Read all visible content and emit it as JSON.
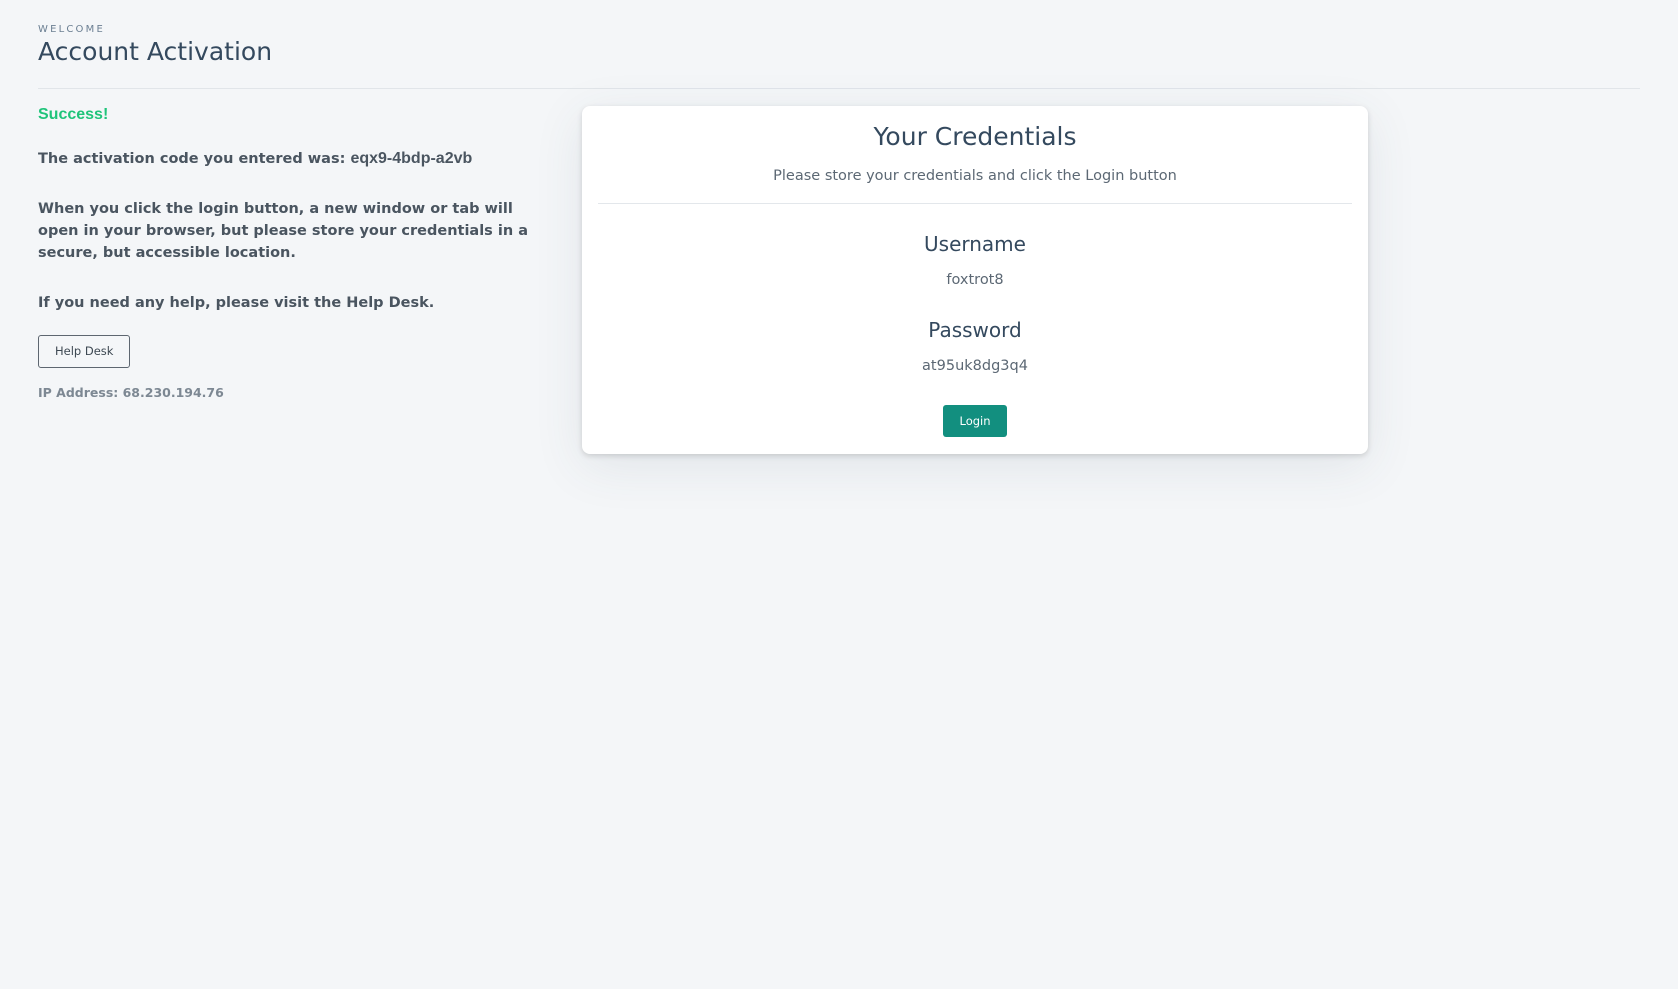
{
  "header": {
    "eyebrow": "WELCOME",
    "title": "Account Activation"
  },
  "left": {
    "success": "Success!",
    "activation_prefix": "The activation code you entered was: ",
    "activation_code": "eqx9-4bdp-a2vb",
    "login_info": "When you click the login button, a new window or tab will open in your browser, but please store your credentials in a secure, but accessible location.",
    "help_text": "If you need any help, please visit the Help Desk.",
    "helpdesk_button": "Help Desk",
    "ip_address": "IP Address: 68.230.194.76"
  },
  "card": {
    "title": "Your Credentials",
    "subtitle": "Please store your credentials and click the Login button",
    "username_label": "Username",
    "username_value": "foxtrot8",
    "password_label": "Password",
    "password_value": "at95uk8dg3q4",
    "login_button": "Login"
  },
  "colors": {
    "success": "#1fc47a",
    "login_button": "#128f7f",
    "background": "#f4f6f8"
  }
}
